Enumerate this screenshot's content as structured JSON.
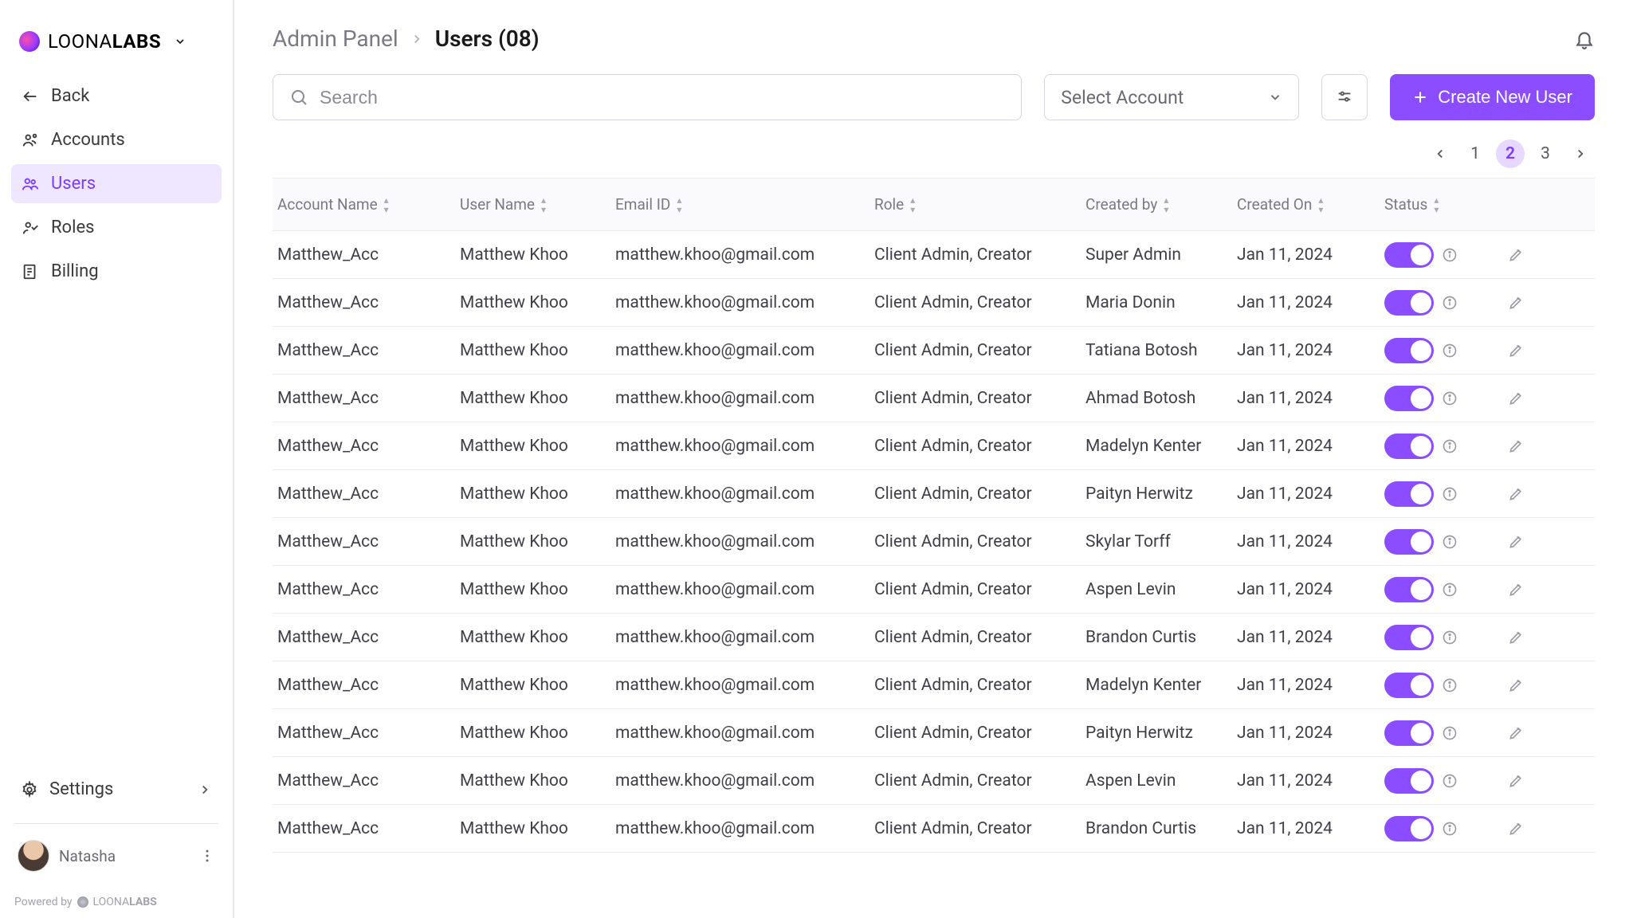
{
  "brand": {
    "name_light": "LOONA",
    "name_bold": "LABS"
  },
  "sidebar": {
    "back": "Back",
    "items": [
      {
        "label": "Accounts"
      },
      {
        "label": "Users"
      },
      {
        "label": "Roles"
      },
      {
        "label": "Billing"
      }
    ],
    "settings": "Settings",
    "profile_name": "Natasha",
    "powered_pre": "Powered by",
    "powered_light": "LOONA",
    "powered_bold": "LABS"
  },
  "breadcrumb": {
    "section": "Admin Panel",
    "page": "Users (08)"
  },
  "toolbar": {
    "search_placeholder": "Search",
    "select_account": "Select Account",
    "create_label": "Create New User"
  },
  "pagination": {
    "pages": [
      "1",
      "2",
      "3"
    ],
    "current": "2"
  },
  "columns": [
    "Account Name",
    "User Name",
    "Email ID",
    "Role",
    "Created by",
    "Created On",
    "Status"
  ],
  "rows": [
    {
      "account": "Matthew_Acc",
      "user": "Matthew Khoo",
      "email": "matthew.khoo@gmail.com",
      "role": "Client Admin, Creator",
      "created_by": "Super Admin",
      "created_on": "Jan 11, 2024",
      "status": true
    },
    {
      "account": "Matthew_Acc",
      "user": "Matthew Khoo",
      "email": "matthew.khoo@gmail.com",
      "role": "Client Admin, Creator",
      "created_by": "Maria Donin",
      "created_on": "Jan 11, 2024",
      "status": true
    },
    {
      "account": "Matthew_Acc",
      "user": "Matthew Khoo",
      "email": "matthew.khoo@gmail.com",
      "role": "Client Admin, Creator",
      "created_by": "Tatiana Botosh",
      "created_on": "Jan 11, 2024",
      "status": true
    },
    {
      "account": "Matthew_Acc",
      "user": "Matthew Khoo",
      "email": "matthew.khoo@gmail.com",
      "role": "Client Admin, Creator",
      "created_by": "Ahmad Botosh",
      "created_on": "Jan 11, 2024",
      "status": true
    },
    {
      "account": "Matthew_Acc",
      "user": "Matthew Khoo",
      "email": "matthew.khoo@gmail.com",
      "role": "Client Admin, Creator",
      "created_by": "Madelyn Kenter",
      "created_on": "Jan 11, 2024",
      "status": true
    },
    {
      "account": "Matthew_Acc",
      "user": "Matthew Khoo",
      "email": "matthew.khoo@gmail.com",
      "role": "Client Admin, Creator",
      "created_by": "Paityn Herwitz",
      "created_on": "Jan 11, 2024",
      "status": true
    },
    {
      "account": "Matthew_Acc",
      "user": "Matthew Khoo",
      "email": "matthew.khoo@gmail.com",
      "role": "Client Admin, Creator",
      "created_by": "Skylar Torff",
      "created_on": "Jan 11, 2024",
      "status": true
    },
    {
      "account": "Matthew_Acc",
      "user": "Matthew Khoo",
      "email": "matthew.khoo@gmail.com",
      "role": "Client Admin, Creator",
      "created_by": "Aspen Levin",
      "created_on": "Jan 11, 2024",
      "status": true
    },
    {
      "account": "Matthew_Acc",
      "user": "Matthew Khoo",
      "email": "matthew.khoo@gmail.com",
      "role": "Client Admin, Creator",
      "created_by": "Brandon Curtis",
      "created_on": "Jan 11, 2024",
      "status": true
    },
    {
      "account": "Matthew_Acc",
      "user": "Matthew Khoo",
      "email": "matthew.khoo@gmail.com",
      "role": "Client Admin, Creator",
      "created_by": "Madelyn Kenter",
      "created_on": "Jan 11, 2024",
      "status": true
    },
    {
      "account": "Matthew_Acc",
      "user": "Matthew Khoo",
      "email": "matthew.khoo@gmail.com",
      "role": "Client Admin, Creator",
      "created_by": "Paityn Herwitz",
      "created_on": "Jan 11, 2024",
      "status": true
    },
    {
      "account": "Matthew_Acc",
      "user": "Matthew Khoo",
      "email": "matthew.khoo@gmail.com",
      "role": "Client Admin, Creator",
      "created_by": "Aspen Levin",
      "created_on": "Jan 11, 2024",
      "status": true
    },
    {
      "account": "Matthew_Acc",
      "user": "Matthew Khoo",
      "email": "matthew.khoo@gmail.com",
      "role": "Client Admin, Creator",
      "created_by": "Brandon Curtis",
      "created_on": "Jan 11, 2024",
      "status": true
    }
  ]
}
